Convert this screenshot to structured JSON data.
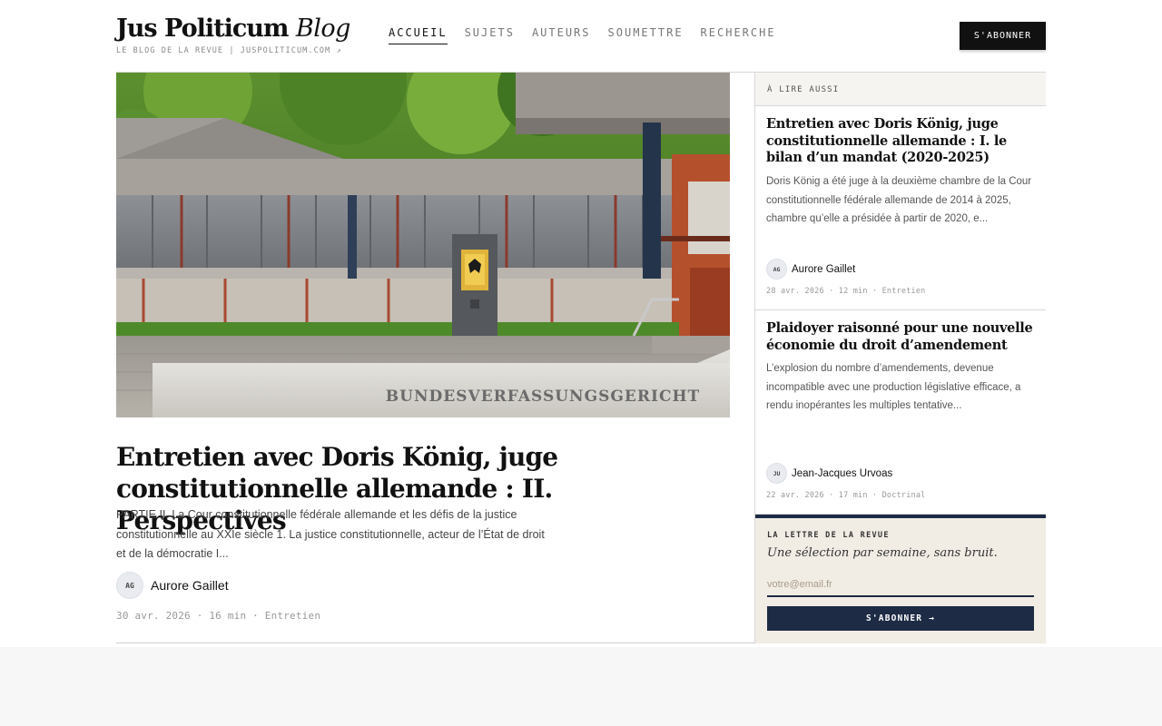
{
  "header": {
    "brand_bold": "Jus Politicum",
    "brand_italic": "Blog",
    "brand_sub": "LE BLOG DE LA REVUE | JUSPOLITICUM.COM ↗",
    "nav": [
      "ACCUEIL",
      "SUJETS",
      "AUTEURS",
      "SOUMETTRE",
      "RECHERCHE"
    ],
    "active_nav": "ACCUEIL",
    "subscribe_label": "S'ABONNER"
  },
  "hero": {
    "caption": "BUNDESVERFASSUNGSGERICHT"
  },
  "main_article": {
    "title": "Entretien avec Doris König, juge constitutionnelle allemande : II. Perspectives",
    "excerpt": "PARTIE II. La Cour constitutionnelle fédérale allemande et les défis de la justice constitutionnelle au XXIe siècle 1. La justice constitutionnelle, acteur de l’État de droit et de la démocratie I...",
    "author_initials": "AG",
    "author": "Aurore Gaillet",
    "meta": "30 avr. 2026 · 16 min · Entretien"
  },
  "sidebar": {
    "heading": "À LIRE AUSSI",
    "cards": [
      {
        "title": "Entretien avec Doris König, juge constitutionnelle allemande : I. le bilan d’un mandat (2020-2025)",
        "excerpt": "Doris König a été juge à la deuxième chambre de la Cour constitutionnelle fédérale allemande de 2014 à 2025, chambre qu’elle a présidée à partir de 2020, e...",
        "author_initials": "AG",
        "author": "Aurore Gaillet",
        "meta": "28 avr. 2026 · 12 min · Entretien"
      },
      {
        "title": "Plaidoyer raisonné pour une nouvelle économie du droit d’amendement",
        "excerpt": "L’explosion du nombre d’amendements, devenue incompatible avec une production législative efficace, a rendu inopérantes les multiples tentative...",
        "author_initials": "JU",
        "author": "Jean-Jacques Urvoas",
        "meta": "22 avr. 2026 · 17 min · Doctrinal"
      }
    ],
    "newsletter": {
      "label": "LA LETTRE DE LA REVUE",
      "tagline": "Une sélection par semaine, sans bruit.",
      "placeholder": "votre@email.fr",
      "button": "S'ABONNER →"
    }
  },
  "colors": {
    "navy": "#1d2b45",
    "black": "#111111",
    "newsletter_bg": "#f1ece4"
  }
}
